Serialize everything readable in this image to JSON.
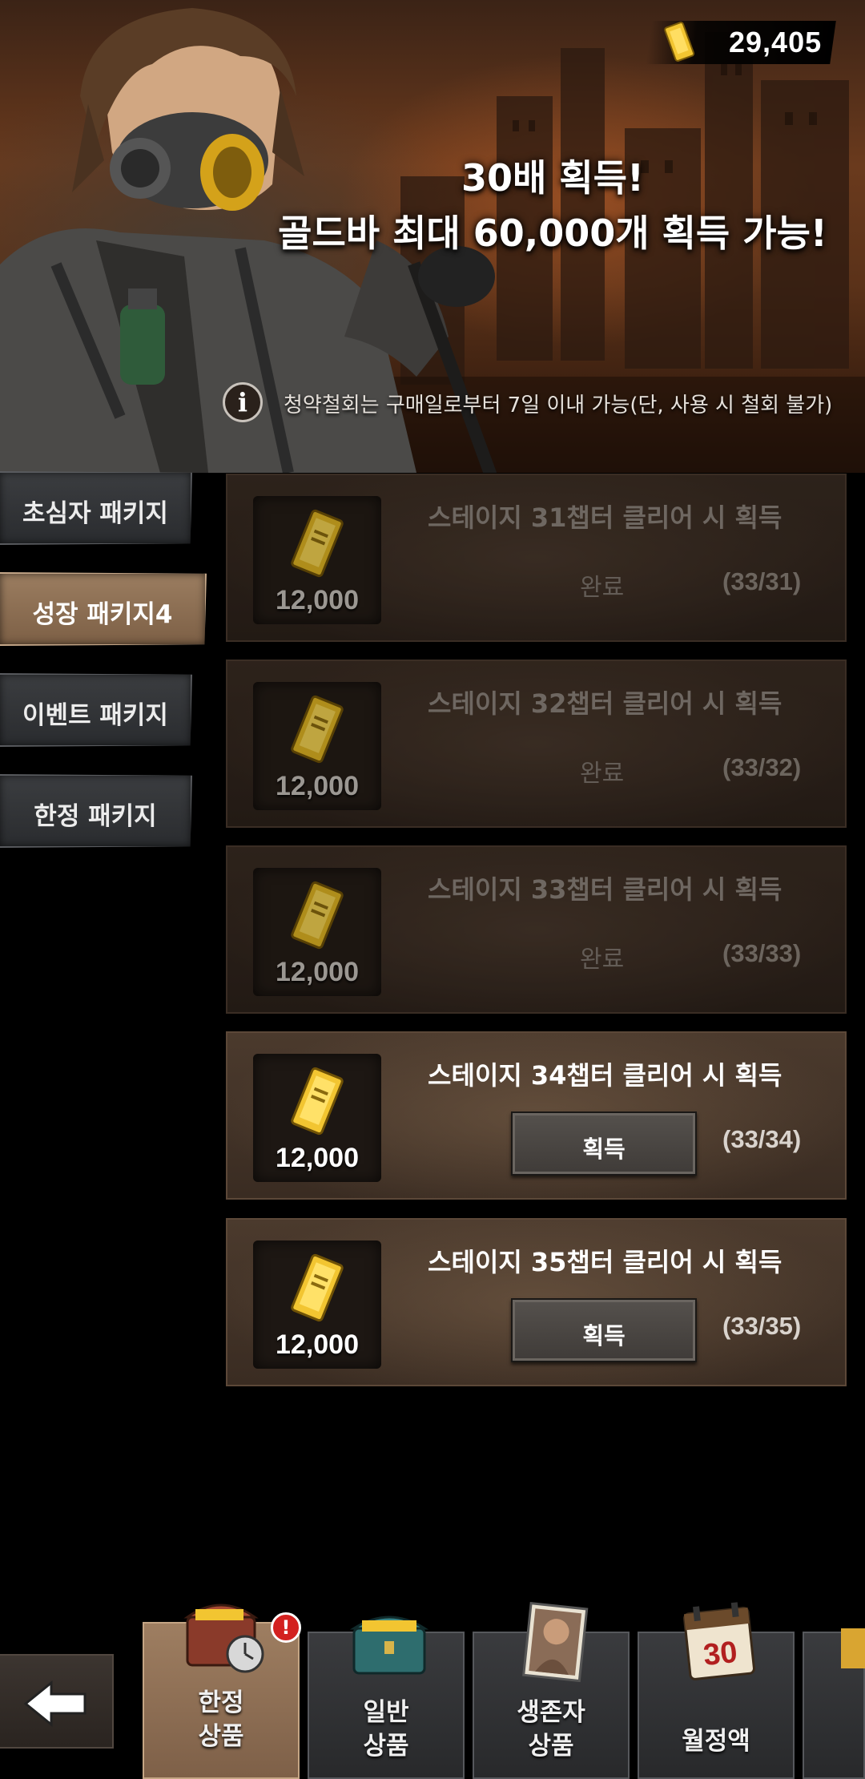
{
  "header": {
    "gold_balance": "29,405",
    "promo_line1": "30배 획득!",
    "promo_line2": "골드바 최대 60,000개 획득 가능!",
    "notice": "청약철회는 구매일로부터 7일 이내 가능(단, 사용 시 철회 불가)"
  },
  "categories": [
    {
      "label": "초심자 패키지",
      "active": false
    },
    {
      "label": "성장 패키지4",
      "active": true
    },
    {
      "label": "이벤트 패키지",
      "active": false
    },
    {
      "label": "한정 패키지",
      "active": false
    }
  ],
  "rewards": [
    {
      "title": "스테이지 31챕터 클리어 시 획득",
      "amount": "12,000",
      "state": "완료",
      "progress": "(33/31)"
    },
    {
      "title": "스테이지 32챕터 클리어 시 획득",
      "amount": "12,000",
      "state": "완료",
      "progress": "(33/32)"
    },
    {
      "title": "스테이지 33챕터 클리어 시 획득",
      "amount": "12,000",
      "state": "완료",
      "progress": "(33/33)"
    },
    {
      "title": "스테이지 34챕터 클리어 시 획득",
      "amount": "12,000",
      "button": "획득",
      "progress": "(33/34)"
    },
    {
      "title": "스테이지 35챕터 클리어 시 획득",
      "amount": "12,000",
      "button": "획득",
      "progress": "(33/35)"
    }
  ],
  "bottom_nav": {
    "tabs": [
      {
        "label_line1": "한정",
        "label_line2": "상품",
        "icon": "chest-clock-icon",
        "active": true,
        "badge": "!"
      },
      {
        "label_line1": "일반",
        "label_line2": "상품",
        "icon": "chest-icon",
        "active": false
      },
      {
        "label_line1": "생존자",
        "label_line2": "상품",
        "icon": "survivor-portrait-icon",
        "active": false
      },
      {
        "label_line1": "월정액",
        "label_line2": "",
        "icon": "calendar-30-icon",
        "active": false,
        "icon_text": "30"
      }
    ]
  },
  "colors": {
    "gold": "#f2c531",
    "active_tab": "#8f6f53",
    "badge": "#d3211f"
  }
}
